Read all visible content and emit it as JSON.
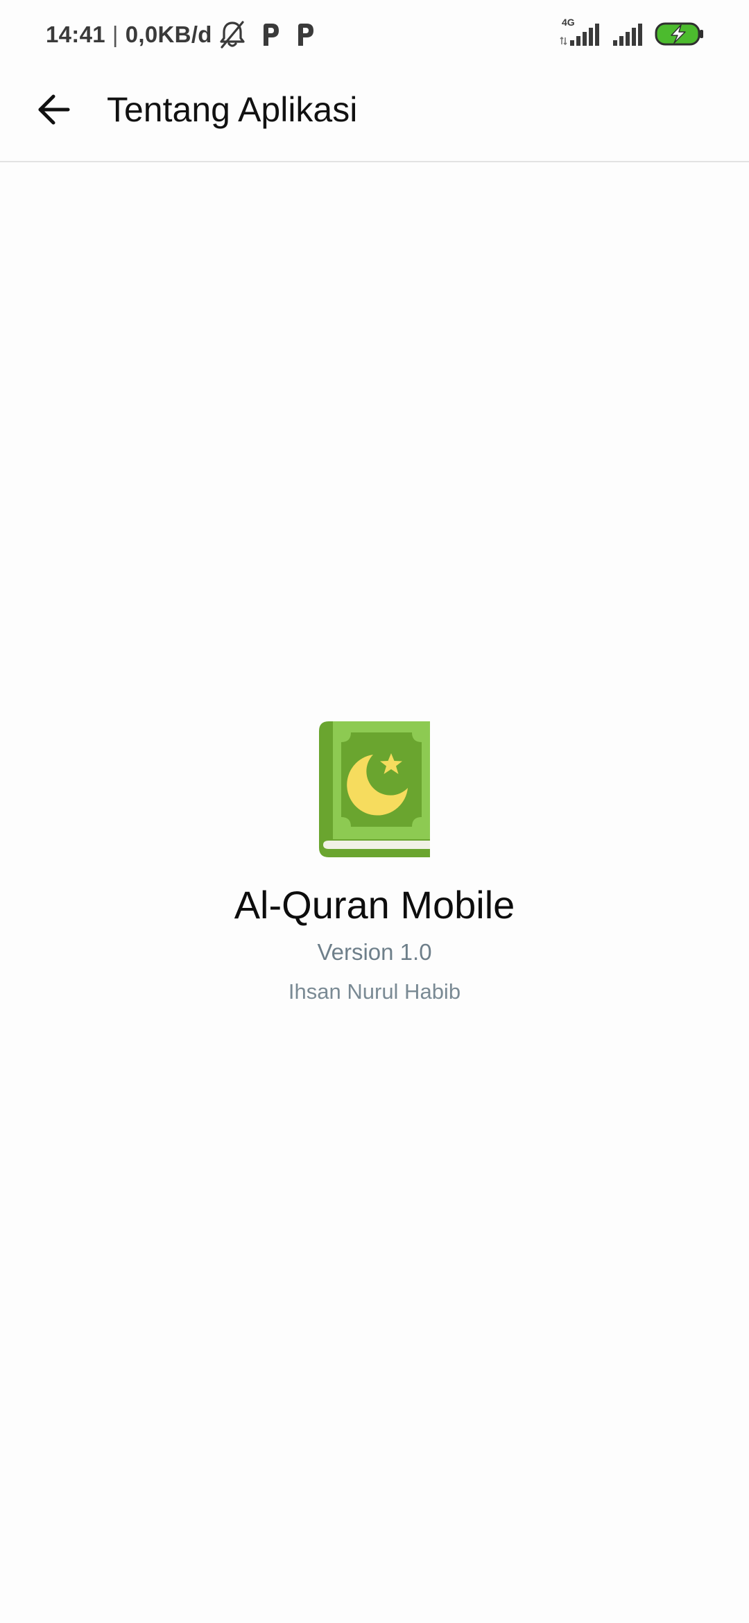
{
  "status_bar": {
    "time": "14:41",
    "separator": "|",
    "data_rate": "0,0KB/d",
    "network_type": "4G",
    "icons": [
      "bell-off-icon",
      "parking-app-icon",
      "parking-app-icon",
      "signal-4g-icon",
      "signal-icon",
      "battery-charging-icon"
    ],
    "battery_color": "#4cbb2e"
  },
  "app_bar": {
    "back_icon": "arrow-left-icon",
    "title": "Tentang Aplikasi"
  },
  "about": {
    "logo_icon": "quran-book-icon",
    "app_name": "Al-Quran Mobile",
    "version": "Version 1.0",
    "author": "Ihsan Nurul Habib"
  },
  "colors": {
    "background": "#fdfdfd",
    "book_green_dark": "#6aa52f",
    "book_green_light": "#8dca52",
    "moon_yellow": "#f6dc5e",
    "secondary_text": "#6e7f8a"
  }
}
